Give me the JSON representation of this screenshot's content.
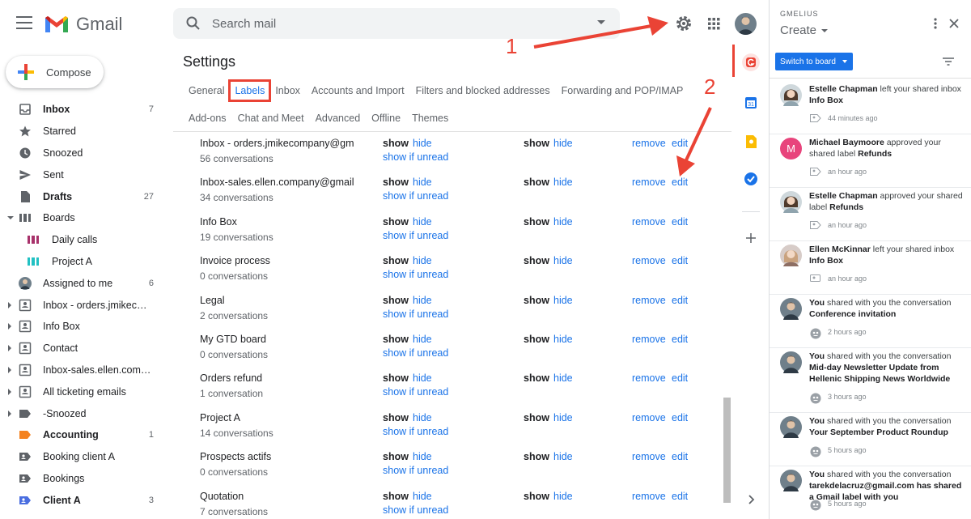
{
  "header": {
    "app_name": "Gmail",
    "search_placeholder": "Search mail"
  },
  "nav": {
    "compose_label": "Compose",
    "items": [
      {
        "label": "Inbox",
        "count": "7",
        "bold": true,
        "icon": "inbox-icon"
      },
      {
        "label": "Starred",
        "count": "",
        "icon": "star-icon"
      },
      {
        "label": "Snoozed",
        "count": "",
        "icon": "clock-icon"
      },
      {
        "label": "Sent",
        "count": "",
        "icon": "send-icon"
      },
      {
        "label": "Drafts",
        "count": "27",
        "bold": true,
        "icon": "draft-icon"
      },
      {
        "label": "Boards",
        "count": "",
        "icon": "board-icon",
        "caret": "down"
      },
      {
        "label": "Daily calls",
        "count": "",
        "icon": "board-item-icon",
        "sub": true,
        "color": "#a8326b"
      },
      {
        "label": "Project A",
        "count": "",
        "icon": "board-item-icon",
        "sub": true,
        "color": "#22c1c3"
      },
      {
        "label": "Assigned to me",
        "count": "6",
        "icon": "avatar-icon"
      },
      {
        "label": "Inbox - orders.jmikecom...",
        "count": "",
        "icon": "shared-inbox-icon",
        "caret": "right"
      },
      {
        "label": "Info Box",
        "count": "",
        "icon": "shared-inbox-icon",
        "caret": "right"
      },
      {
        "label": "Contact",
        "count": "",
        "icon": "shared-inbox-icon",
        "caret": "right"
      },
      {
        "label": "Inbox-sales.ellen.compa...",
        "count": "",
        "icon": "shared-inbox-icon",
        "caret": "right"
      },
      {
        "label": "All ticketing emails",
        "count": "",
        "icon": "shared-inbox-icon",
        "caret": "right"
      },
      {
        "label": "-Snoozed",
        "count": "",
        "icon": "label-icon",
        "caret": "right"
      },
      {
        "label": "Accounting",
        "count": "1",
        "bold": true,
        "icon": "label-icon",
        "color": "#f4821f"
      },
      {
        "label": "Booking client A",
        "count": "",
        "icon": "shared-label-icon"
      },
      {
        "label": "Bookings",
        "count": "",
        "icon": "shared-label-icon"
      },
      {
        "label": "Client A",
        "count": "3",
        "bold": true,
        "icon": "shared-label-icon",
        "color": "#4a6ee0"
      }
    ]
  },
  "settings": {
    "title": "Settings",
    "tabs_row1": [
      "General",
      "Labels",
      "Inbox",
      "Accounts and Import",
      "Filters and blocked addresses",
      "Forwarding and POP/IMAP"
    ],
    "tabs_row2": [
      "Add-ons",
      "Chat and Meet",
      "Advanced",
      "Offline",
      "Themes"
    ],
    "active_tab": "Labels",
    "labels": [
      {
        "name": "Inbox - orders.jmikecompany@gm",
        "count": "56 conversations"
      },
      {
        "name": "Inbox-sales.ellen.company@gmail",
        "count": "34 conversations"
      },
      {
        "name": "Info Box",
        "count": "19 conversations"
      },
      {
        "name": "Invoice process",
        "count": "0 conversations"
      },
      {
        "name": "Legal",
        "count": "2 conversations"
      },
      {
        "name": "My GTD board",
        "count": "0 conversations"
      },
      {
        "name": "Orders refund",
        "count": "1 conversation"
      },
      {
        "name": "Project A",
        "count": "14 conversations"
      },
      {
        "name": "Prospects actifs",
        "count": "0 conversations"
      },
      {
        "name": "Quotation",
        "count": "7 conversations"
      }
    ],
    "show_label": "show",
    "hide_label": "hide",
    "show_if_unread_label": "show if unread",
    "remove_label": "remove",
    "edit_label": "edit"
  },
  "annotations": {
    "one": "1",
    "two": "2"
  },
  "gmelius": {
    "brand": "GMELIUS",
    "create_label": "Create",
    "switch_label": "Switch to board",
    "feed": [
      {
        "actor": "Estelle Chapman",
        "action": " left your shared inbox ",
        "target": "Info Box",
        "time": "44 minutes ago",
        "avatar": "photo-f1"
      },
      {
        "actor": "Michael Baymoore",
        "action": " approved your shared label ",
        "target": "Refunds",
        "time": "an hour ago",
        "avatar": "initial",
        "initial": "M"
      },
      {
        "actor": "Estelle Chapman",
        "action": " approved your shared label ",
        "target": "Refunds",
        "time": "an hour ago",
        "avatar": "photo-f1"
      },
      {
        "actor": "Ellen McKinnar",
        "action": " left your shared inbox ",
        "target": "Info Box",
        "time": "an hour ago",
        "avatar": "photo-f2"
      },
      {
        "actor": "You",
        "action": " shared with you the conversation ",
        "target": "Conference invitation",
        "time": "2 hours ago",
        "avatar": "photo-m"
      },
      {
        "actor": "You",
        "action": " shared with you the conversation ",
        "target": "Mid-day Newsletter Update from Hellenic Shipping News Worldwide",
        "time": "3 hours ago",
        "avatar": "photo-m"
      },
      {
        "actor": "You",
        "action": " shared with you the conversation ",
        "target": "Your September Product Roundup",
        "time": "5 hours ago",
        "avatar": "photo-m"
      },
      {
        "actor": "You",
        "action": " shared with you the conversation ",
        "target": "tarekdelacruz@gmail.com has shared a Gmail label with you",
        "time": "5 hours ago",
        "avatar": "photo-m"
      }
    ]
  },
  "colors": {
    "accent": "#1a73e8",
    "annotation": "#ea4335"
  }
}
